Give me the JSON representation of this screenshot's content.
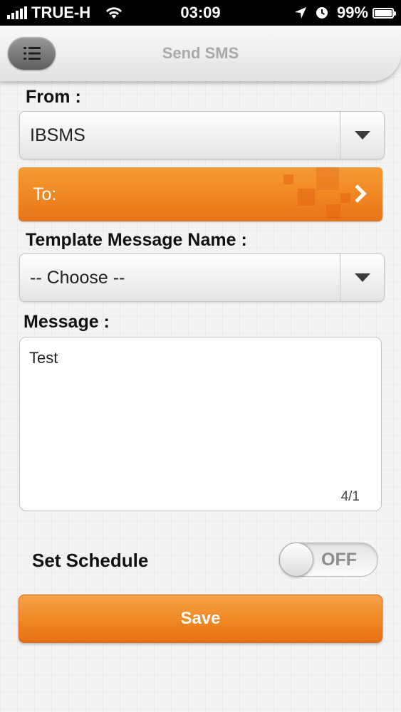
{
  "status_bar": {
    "carrier": "TRUE-H",
    "time": "03:09",
    "battery": "99%",
    "battery_level": 0.99
  },
  "navbar": {
    "title": "Send SMS",
    "menu_icon": "list-icon"
  },
  "from": {
    "label": "From :",
    "value": "IBSMS"
  },
  "to": {
    "label": "To:"
  },
  "template": {
    "label": "Template Message Name :",
    "value": "-- Choose --"
  },
  "message": {
    "label": "Message :",
    "value": "Test",
    "counter": "4/1"
  },
  "schedule": {
    "label": "Set Schedule",
    "toggle_state": "OFF"
  },
  "save": {
    "label": "Save"
  },
  "colors": {
    "accent": "#f08a24",
    "navbar_title": "#a9a9a9"
  }
}
